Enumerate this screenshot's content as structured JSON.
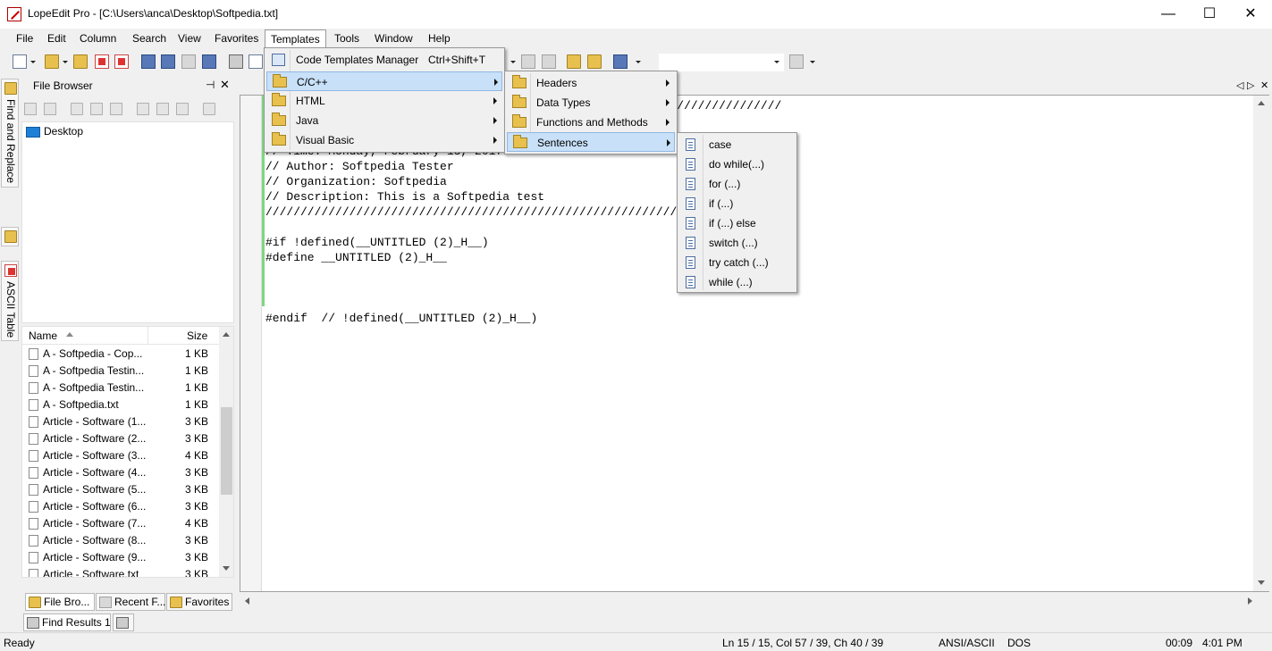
{
  "window": {
    "title": "LopeEdit Pro - [C:\\Users\\anca\\Desktop\\Softpedia.txt]",
    "controls": {
      "minimize": "—",
      "maximize": "☐",
      "close": "✕"
    }
  },
  "menubar": [
    "File",
    "Edit",
    "Column",
    "Search",
    "View",
    "Favorites",
    "Templates",
    "Tools",
    "Window",
    "Help"
  ],
  "left_strip": {
    "find_replace": "Find and Replace",
    "ascii_table": "ASCII Table"
  },
  "file_browser": {
    "title": "File Browser",
    "pin": "⊣",
    "close": "✕",
    "tree_root": "Desktop",
    "columns": {
      "name": "Name",
      "size": "Size"
    },
    "files": [
      {
        "name": "A - Softpedia - Cop...",
        "size": "1 KB"
      },
      {
        "name": "A - Softpedia Testin...",
        "size": "1 KB"
      },
      {
        "name": "A - Softpedia Testin...",
        "size": "1 KB"
      },
      {
        "name": "A - Softpedia.txt",
        "size": "1 KB"
      },
      {
        "name": "Article - Software (1...",
        "size": "3 KB"
      },
      {
        "name": "Article - Software (2...",
        "size": "3 KB"
      },
      {
        "name": "Article - Software (3...",
        "size": "4 KB"
      },
      {
        "name": "Article - Software (4...",
        "size": "3 KB"
      },
      {
        "name": "Article - Software (5...",
        "size": "3 KB"
      },
      {
        "name": "Article - Software (6...",
        "size": "3 KB"
      },
      {
        "name": "Article - Software (7...",
        "size": "4 KB"
      },
      {
        "name": "Article - Software (8...",
        "size": "3 KB"
      },
      {
        "name": "Article - Software (9...",
        "size": "3 KB"
      },
      {
        "name": "Article - Software.txt",
        "size": "3 KB"
      }
    ],
    "bottom_tabs": [
      "File Bro...",
      "Recent F...",
      "Favorites"
    ]
  },
  "editor": {
    "code_lines": [
      "//////////////////////////////////////////////////////////////////////////",
      "",
      "",
      "// Time: Monday, February 13, 2017 16:01:22 - 16:01:22 am",
      "// Author: Softpedia Tester",
      "// Organization: Softpedia",
      "// Description: This is a Softpedia test",
      "//////////////////////////////////////////////////////////////////////////",
      "",
      "#if !defined(__UNTITLED (2)_H__)",
      "#define __UNTITLED (2)_H__",
      "",
      "",
      "",
      "#endif  // !defined(__UNTITLED (2)_H__)"
    ],
    "nav": {
      "prev": "◁",
      "next": "▷",
      "close": "✕"
    }
  },
  "templates_menu": {
    "items": [
      {
        "label": "Code Templates Manager",
        "shortcut": "Ctrl+Shift+T"
      },
      {
        "label": "C/C++",
        "submenu": true
      },
      {
        "label": "HTML",
        "submenu": true
      },
      {
        "label": "Java",
        "submenu": true
      },
      {
        "label": "Visual Basic",
        "submenu": true
      }
    ]
  },
  "cpp_menu": {
    "items": [
      "Headers",
      "Data Types",
      "Functions and Methods",
      "Sentences"
    ]
  },
  "sentences_menu": {
    "items": [
      "case",
      "do while(...)",
      "for (...)",
      "if (...)",
      "if (...) else",
      "switch (...)",
      "try catch (...)",
      "while (...)"
    ]
  },
  "find_bar": {
    "tab": "Find Results 1"
  },
  "status": {
    "state": "Ready",
    "position": "Ln 15 / 15, Col 57 / 39, Ch 40 / 39",
    "encoding": "ANSI/ASCII",
    "line_ending": "DOS",
    "elapsed": "00:09",
    "clock": "4:01 PM"
  },
  "colors": {
    "menu_highlight": "#c8e0f8",
    "change_bar": "#7fd87f",
    "folder": "#e8c04e"
  }
}
